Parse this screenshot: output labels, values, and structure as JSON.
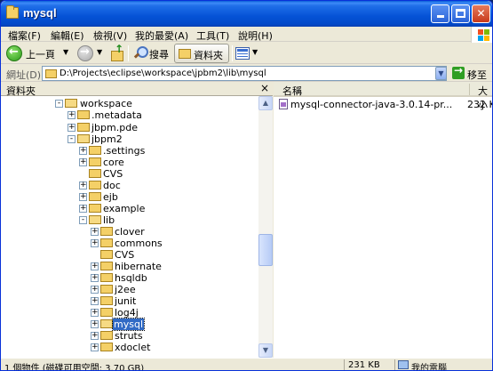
{
  "window": {
    "title": "mysql"
  },
  "menu": [
    {
      "label": "檔案(F)"
    },
    {
      "label": "編輯(E)"
    },
    {
      "label": "檢視(V)"
    },
    {
      "label": "我的最愛(A)"
    },
    {
      "label": "工具(T)"
    },
    {
      "label": "說明(H)"
    }
  ],
  "toolbar": {
    "back_label": "上一頁",
    "search_label": "搜尋",
    "folders_label": "資料夾"
  },
  "address": {
    "label": "網址(D)",
    "path": "D:\\Projects\\eclipse\\workspace\\jpbm2\\lib\\mysql",
    "go_label": "移至"
  },
  "folder_pane": {
    "title": "資料夾",
    "close_glyph": "×"
  },
  "tree": [
    {
      "label": "workspace",
      "expander": "-",
      "open": true
    },
    {
      "label": ".metadata",
      "expander": "+",
      "open": false
    },
    {
      "label": "jbpm.pde",
      "expander": "+",
      "open": false
    },
    {
      "label": "jbpm2",
      "expander": "-",
      "open": true
    },
    {
      "label": ".settings",
      "expander": "+",
      "open": false
    },
    {
      "label": "core",
      "expander": "+",
      "open": false
    },
    {
      "label": "CVS",
      "expander": "",
      "open": false
    },
    {
      "label": "doc",
      "expander": "+",
      "open": false
    },
    {
      "label": "ejb",
      "expander": "+",
      "open": false
    },
    {
      "label": "example",
      "expander": "+",
      "open": false
    },
    {
      "label": "lib",
      "expander": "-",
      "open": true
    },
    {
      "label": "clover",
      "expander": "+",
      "open": false
    },
    {
      "label": "commons",
      "expander": "+",
      "open": false
    },
    {
      "label": "CVS",
      "expander": "",
      "open": false
    },
    {
      "label": "hibernate",
      "expander": "+",
      "open": false
    },
    {
      "label": "hsqldb",
      "expander": "+",
      "open": false
    },
    {
      "label": "j2ee",
      "expander": "+",
      "open": false
    },
    {
      "label": "junit",
      "expander": "+",
      "open": false
    },
    {
      "label": "log4j",
      "expander": "+",
      "open": false
    },
    {
      "label": "mysql",
      "expander": "+",
      "open": true,
      "selected": true
    },
    {
      "label": "struts",
      "expander": "+",
      "open": false
    },
    {
      "label": "xdoclet",
      "expander": "+",
      "open": false
    }
  ],
  "file_pane": {
    "columns": {
      "name": "名稱",
      "size": "大小"
    },
    "files": [
      {
        "name": "mysql-connector-java-3.0.14-pr...",
        "size": "232 K"
      }
    ]
  },
  "status": {
    "objects": "1 個物件 (磁碟可用空間: 3.70 GB)",
    "size": "231 KB",
    "location": "我的電腦"
  },
  "colors": {
    "titlebar": "#0552d6",
    "selection": "#316ac5",
    "folder": "#f4d067",
    "chrome": "#ece9d8"
  }
}
